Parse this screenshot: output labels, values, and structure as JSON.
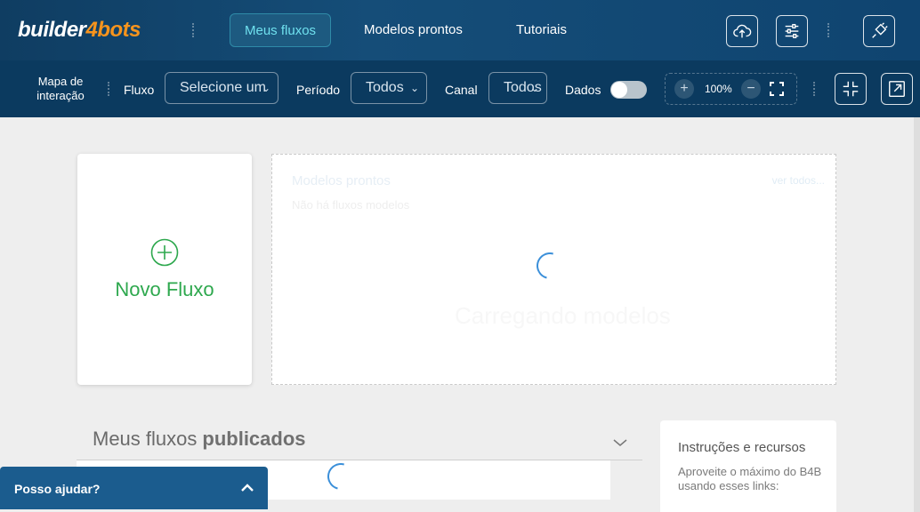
{
  "brand": {
    "part1": "builder",
    "part2": "4bots"
  },
  "nav": {
    "tabs": [
      {
        "label": "Meus fluxos",
        "active": true
      },
      {
        "label": "Modelos prontos",
        "active": false
      },
      {
        "label": "Tutoriais",
        "active": false
      }
    ],
    "icons": [
      "cloud-upload-icon",
      "sliders-icon",
      "plug-icon"
    ]
  },
  "filters": {
    "map_label": "Mapa de interação",
    "map_label_l1": "Mapa de",
    "map_label_l2": "interação",
    "fluxo_label": "Fluxo",
    "fluxo_value": "Selecione um",
    "periodo_label": "Período",
    "periodo_value": "Todos",
    "canal_label": "Canal",
    "canal_value": "Todos",
    "dados_label": "Dados",
    "dados_enabled": false,
    "zoom": "100%"
  },
  "new_flow": {
    "label": "Novo Fluxo"
  },
  "models": {
    "title": "Modelos prontos",
    "subtitle": "Não há fluxos modelos",
    "view_all": "ver todos...",
    "loading_text": "Carregando modelos"
  },
  "published": {
    "title_light": "Meus fluxos",
    "title_bold": "publicados"
  },
  "instructions": {
    "title": "Instruções e recursos",
    "text": "Aproveite o máximo do B4B usando esses links:"
  },
  "help": {
    "label": "Posso ajudar?"
  },
  "colors": {
    "accent": "#6fe0ee",
    "brand_orange": "#f7941d",
    "green": "#2ea84e",
    "nav_bg": "#0f3d62",
    "help_bg": "#1b5c8e"
  }
}
